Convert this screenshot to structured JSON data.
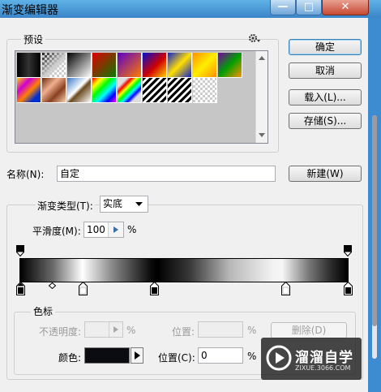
{
  "window": {
    "title": "渐变编辑器",
    "min_glyph": "—",
    "max_glyph": "□",
    "close_glyph": "✕"
  },
  "presets": {
    "label": "预设",
    "menu_icon": "gear-icon",
    "swatches": [
      "black-fill",
      "transparent",
      "black-white",
      "red-green",
      "violet-orange",
      "blue-red-yellow",
      "blue-yellow-blue",
      "orange-yellow-orange",
      "violet-green-orange",
      "yellow-violet-orange-blue",
      "copper",
      "chrome",
      "spectrum",
      "transparent-rainbow",
      "transparent-stripes",
      "transparent-checker"
    ]
  },
  "buttons": {
    "ok": "确定",
    "cancel": "取消",
    "load": "载入(L)...",
    "save": "存储(S)...",
    "new": "新建(W)",
    "delete": "删除(D)"
  },
  "name": {
    "label": "名称(N):",
    "value": "自定"
  },
  "gradient": {
    "type_label": "渐变类型(T):",
    "type_value": "实底",
    "smoothness_label": "平滑度(M):",
    "smoothness_value": "100",
    "smoothness_unit": "%"
  },
  "stops": {
    "group_label": "色标",
    "opacity_label": "不透明度:",
    "opacity_value": "",
    "opacity_unit": "%",
    "opacity_location_label": "位置:",
    "opacity_location_unit": "%",
    "color_label": "颜色:",
    "color_value": "#0b0b12",
    "color_location_label": "位置(C):",
    "color_location_value": "0",
    "color_location_unit": "%"
  },
  "watermark": {
    "name": "溜溜自学",
    "url": "ZIXUE.3066.COM"
  }
}
